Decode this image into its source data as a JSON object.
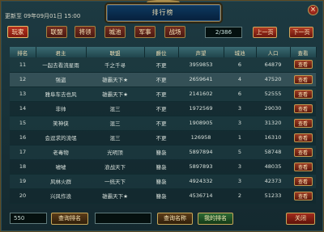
{
  "window": {
    "title": "排行榜",
    "update_time": "更新至 09年09月01日 15:00",
    "close_glyph": "×"
  },
  "tabs": [
    {
      "label": "玩家",
      "active": true
    },
    {
      "label": "联盟",
      "active": false
    },
    {
      "label": "将领",
      "active": false
    },
    {
      "label": "城池",
      "active": false
    },
    {
      "label": "军事",
      "active": false
    },
    {
      "label": "战场",
      "active": false
    }
  ],
  "pager": {
    "value": "2/386",
    "prev_label": "上一页",
    "next_label": "下一页"
  },
  "table": {
    "headers": [
      "排名",
      "君主",
      "联盟",
      "爵位",
      "声望",
      "城池",
      "人口",
      "查看"
    ],
    "rows": [
      {
        "rank": "11",
        "lord": "一起去看流星雨",
        "alliance": "千之千寻",
        "title": "不更",
        "prestige": "3959853",
        "cities": "6",
        "population": "64879",
        "view": "查看"
      },
      {
        "rank": "12",
        "lord": "强盗",
        "alliance": "雄霸天下★",
        "title": "不更",
        "prestige": "2659641",
        "cities": "4",
        "population": "47520",
        "view": "查看"
      },
      {
        "rank": "13",
        "lord": "雅阜车去也风",
        "alliance": "雄霸天下★",
        "title": "不更",
        "prestige": "2141602",
        "cities": "6",
        "population": "52555",
        "view": "查看"
      },
      {
        "rank": "14",
        "lord": "非帅",
        "alliance": "混三",
        "title": "不更",
        "prestige": "1972569",
        "cities": "3",
        "population": "29030",
        "view": "查看"
      },
      {
        "rank": "15",
        "lord": "笑神侠",
        "alliance": "混三",
        "title": "不更",
        "prestige": "1908905",
        "cities": "3",
        "population": "31320",
        "view": "查看"
      },
      {
        "rank": "16",
        "lord": "会逗求的流氓",
        "alliance": "混三",
        "title": "不更",
        "prestige": "126958",
        "cities": "1",
        "population": "16310",
        "view": "查看"
      },
      {
        "rank": "17",
        "lord": "老毒物",
        "alliance": "光明顶",
        "title": "簪袅",
        "prestige": "5897894",
        "cities": "5",
        "population": "58748",
        "view": "查看"
      },
      {
        "rank": "18",
        "lord": "嘘嘘",
        "alliance": "浪战天下",
        "title": "簪袅",
        "prestige": "5897893",
        "cities": "3",
        "population": "48035",
        "view": "查看"
      },
      {
        "rank": "19",
        "lord": "风林火群",
        "alliance": "一统天下",
        "title": "簪袅",
        "prestige": "4924332",
        "cities": "3",
        "population": "42373",
        "view": "查看"
      },
      {
        "rank": "20",
        "lord": "兴风作浪",
        "alliance": "雄霸天下★",
        "title": "簪袅",
        "prestige": "4536714",
        "cities": "2",
        "population": "51233",
        "view": "查看"
      }
    ]
  },
  "bottom": {
    "rank_input_value": "550",
    "query_rank_label": "查询排名",
    "name_input_value": "",
    "query_name_label": "查询名称",
    "my_rank_label": "我的排名",
    "close_label": "关闭"
  }
}
